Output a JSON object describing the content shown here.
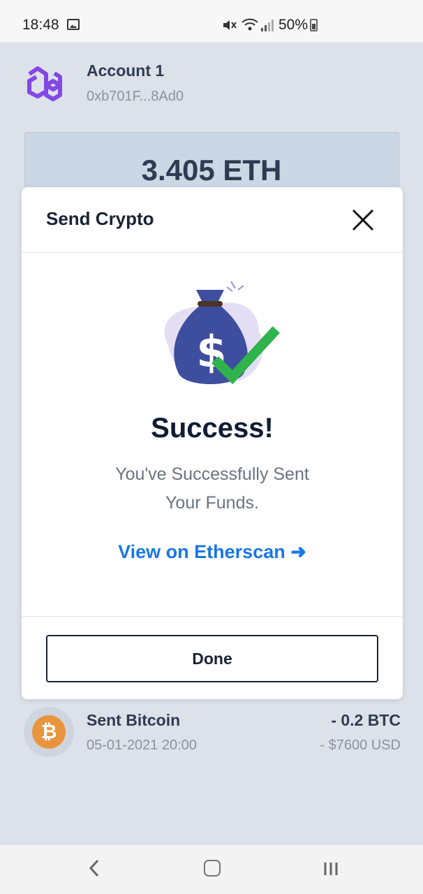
{
  "status_bar": {
    "time": "18:48",
    "battery_percent": "50%",
    "icons": [
      "image-icon",
      "mute-icon",
      "wifi-icon",
      "signal-icon",
      "battery-icon"
    ]
  },
  "account": {
    "name": "Account 1",
    "address": "0xb701F...8Ad0",
    "logo_icon": "polygon-logo-icon",
    "logo_color": "#8247e5"
  },
  "balance": {
    "value": "3.405 ETH"
  },
  "modal": {
    "title": "Send Crypto",
    "close_icon": "close-icon",
    "illustration_icon": "money-bag-check-icon",
    "success_title": "Success!",
    "message_line1": "You've Successfully Sent",
    "message_line2": "Your Funds.",
    "link_label": "View on Etherscan ➜",
    "link_color": "#1877e6",
    "done_label": "Done"
  },
  "transaction": {
    "title": "Sent Bitcoin",
    "date": "05-01-2021 20:00",
    "amount": "- 0.2 BTC",
    "usd": "- $7600 USD",
    "icon": "bitcoin-icon",
    "icon_symbol": "₿",
    "icon_color": "#e9953d"
  },
  "nav_bar": {
    "icons": [
      "back-icon",
      "home-icon",
      "recents-icon"
    ]
  }
}
